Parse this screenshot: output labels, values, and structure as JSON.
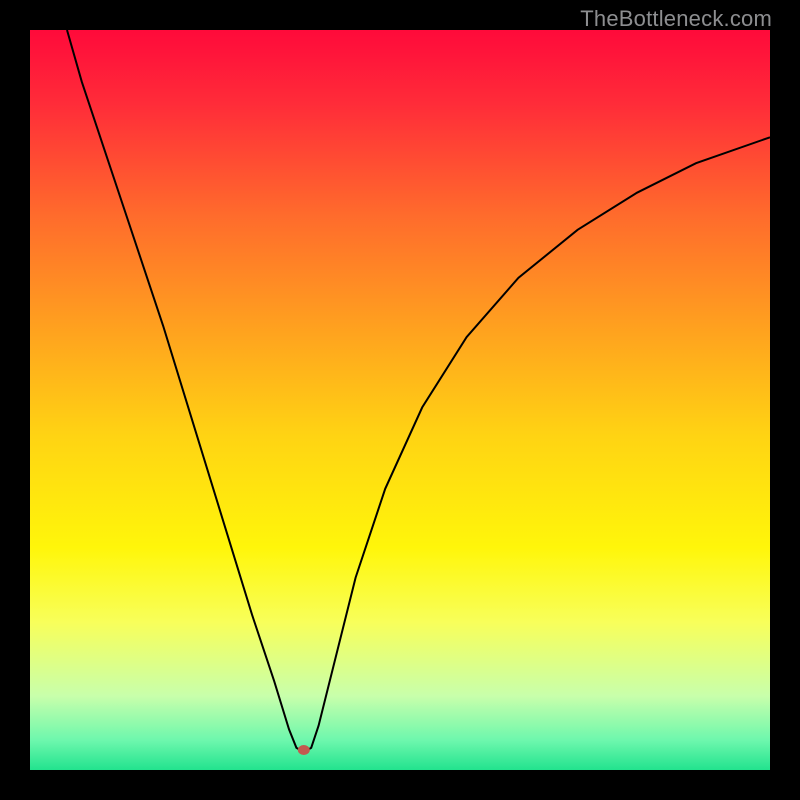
{
  "watermark": "TheBottleneck.com",
  "chart_data": {
    "type": "line",
    "title": "",
    "xlabel": "",
    "ylabel": "",
    "xlim": [
      0,
      100
    ],
    "ylim": [
      100,
      0
    ],
    "gradient_stops": [
      {
        "offset": 0,
        "color": "#ff0a3a"
      },
      {
        "offset": 10,
        "color": "#ff2c39"
      },
      {
        "offset": 25,
        "color": "#ff6b2c"
      },
      {
        "offset": 40,
        "color": "#ffa01f"
      },
      {
        "offset": 55,
        "color": "#ffd413"
      },
      {
        "offset": 70,
        "color": "#fff60a"
      },
      {
        "offset": 80,
        "color": "#f8ff5a"
      },
      {
        "offset": 90,
        "color": "#c8ffab"
      },
      {
        "offset": 96,
        "color": "#6df7ad"
      },
      {
        "offset": 100,
        "color": "#22e38e"
      }
    ],
    "series": [
      {
        "name": "bottleneck-curve",
        "points": [
          {
            "x": 5.0,
            "y": 0.0
          },
          {
            "x": 7.0,
            "y": 7.0
          },
          {
            "x": 10.0,
            "y": 16.0
          },
          {
            "x": 14.0,
            "y": 28.0
          },
          {
            "x": 18.0,
            "y": 40.0
          },
          {
            "x": 22.0,
            "y": 53.0
          },
          {
            "x": 26.0,
            "y": 66.0
          },
          {
            "x": 30.0,
            "y": 79.0
          },
          {
            "x": 33.0,
            "y": 88.0
          },
          {
            "x": 35.0,
            "y": 94.5
          },
          {
            "x": 36.0,
            "y": 97.0
          },
          {
            "x": 36.5,
            "y": 97.3
          },
          {
            "x": 37.5,
            "y": 97.3
          },
          {
            "x": 38.0,
            "y": 97.0
          },
          {
            "x": 39.0,
            "y": 94.0
          },
          {
            "x": 41.0,
            "y": 86.0
          },
          {
            "x": 44.0,
            "y": 74.0
          },
          {
            "x": 48.0,
            "y": 62.0
          },
          {
            "x": 53.0,
            "y": 51.0
          },
          {
            "x": 59.0,
            "y": 41.5
          },
          {
            "x": 66.0,
            "y": 33.5
          },
          {
            "x": 74.0,
            "y": 27.0
          },
          {
            "x": 82.0,
            "y": 22.0
          },
          {
            "x": 90.0,
            "y": 18.0
          },
          {
            "x": 100.0,
            "y": 14.5
          }
        ]
      }
    ],
    "marker": {
      "x": 37.0,
      "y": 97.3,
      "rx": 6,
      "ry": 5,
      "color": "#c35a4f"
    }
  }
}
